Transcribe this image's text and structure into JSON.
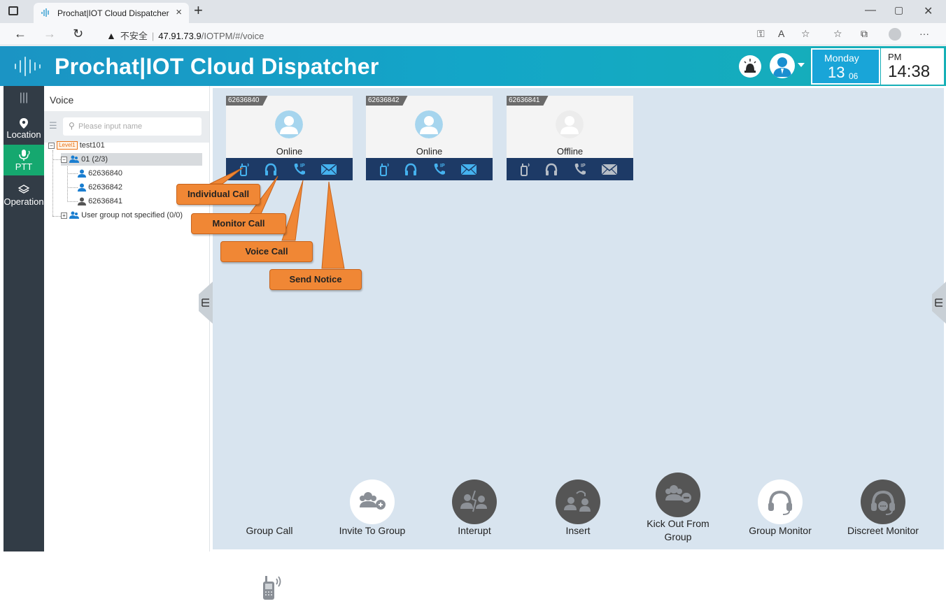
{
  "browser": {
    "tab_title": "Prochat|IOT Cloud Dispatcher",
    "url_security": "不安全",
    "url_host": "47.91.73.9",
    "url_path": "/IOTPM/#/voice"
  },
  "header": {
    "title": "Prochat|IOT Cloud Dispatcher",
    "day": "Monday",
    "date": "13",
    "month": "06",
    "ampm": "PM",
    "time": "14:38"
  },
  "nav": {
    "items": [
      {
        "label": "Location",
        "icon": "location-pin-icon"
      },
      {
        "label": "PTT",
        "icon": "microphone-icon",
        "active": true
      },
      {
        "label": "Operation",
        "icon": "layers-icon"
      }
    ]
  },
  "tree": {
    "title": "Voice",
    "search_placeholder": "Please input name",
    "level_badge": "Level1",
    "root": "test101",
    "group": "01 (2/3)",
    "users": [
      "62636840",
      "62636842",
      "62636841"
    ],
    "unassigned": "User group not specified (0/0)"
  },
  "cards": [
    {
      "id": "62636840",
      "status": "Online",
      "online": true
    },
    {
      "id": "62636842",
      "status": "Online",
      "online": true
    },
    {
      "id": "62636841",
      "status": "Offline",
      "online": false
    }
  ],
  "callouts": {
    "individual": "Individual Call",
    "monitor": "Monitor Call",
    "voice": "Voice Call",
    "notice": "Send Notice"
  },
  "actions": [
    {
      "label": "Group Call",
      "icon": "walkie-talkie-icon",
      "enabled": true
    },
    {
      "label": "Invite To Group",
      "icon": "invite-group-icon",
      "enabled": true
    },
    {
      "label": "Interupt",
      "icon": "interrupt-icon",
      "enabled": false
    },
    {
      "label": "Insert",
      "icon": "insert-icon",
      "enabled": false
    },
    {
      "label": "Kick Out From Group",
      "icon": "kick-out-icon",
      "enabled": false
    },
    {
      "label": "Group Monitor",
      "icon": "headset-icon",
      "enabled": true
    },
    {
      "label": "Discreet Monitor",
      "icon": "discreet-headset-icon",
      "enabled": false
    }
  ],
  "colors": {
    "header_start": "#1b94c4",
    "header_end": "#16b0b6",
    "nav_bg": "#323c46",
    "nav_active": "#15a86f",
    "card_actions": "#1d3a66",
    "callout": "#f08735"
  }
}
